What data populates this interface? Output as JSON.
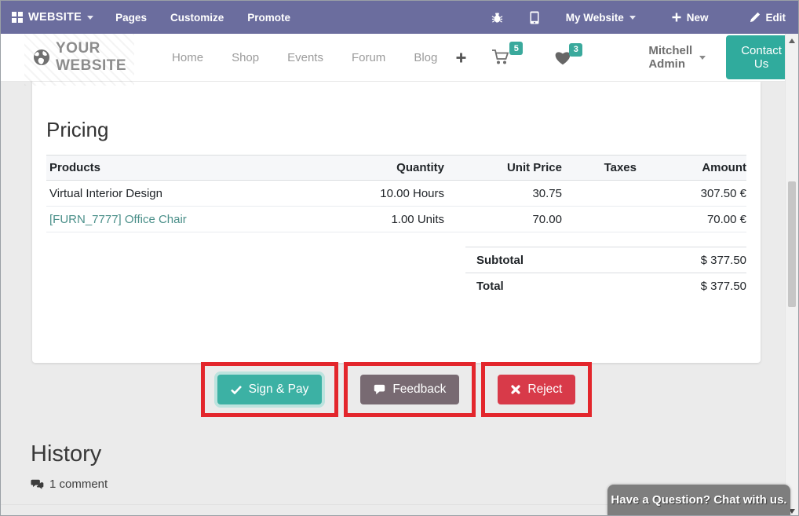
{
  "topbar": {
    "app_label": "WEBSITE",
    "items": [
      "Pages",
      "Customize",
      "Promote"
    ],
    "my_website": "My Website",
    "new_label": "New",
    "edit_label": "Edit"
  },
  "navbar": {
    "logo": "YOUR WEBSITE",
    "items": [
      "Home",
      "Shop",
      "Events",
      "Forum",
      "Blog"
    ],
    "cart_count": "5",
    "wishlist_count": "3",
    "user": "Mitchell Admin",
    "contact": "Contact Us"
  },
  "pricing": {
    "title": "Pricing",
    "headers": [
      "Products",
      "Quantity",
      "Unit Price",
      "Taxes",
      "Amount"
    ],
    "rows": [
      {
        "product": "Virtual Interior Design",
        "quantity": "10.00 Hours",
        "unit_price": "30.75",
        "taxes": "",
        "amount": "307.50 €"
      },
      {
        "product": "[FURN_7777] Office Chair",
        "quantity": "1.00 Units",
        "unit_price": "70.00",
        "taxes": "",
        "amount": "70.00 €"
      }
    ],
    "totals": [
      {
        "label": "Subtotal",
        "value": "$ 377.50"
      },
      {
        "label": "Total",
        "value": "$ 377.50"
      }
    ]
  },
  "actions": {
    "sign_pay": "Sign & Pay",
    "feedback": "Feedback",
    "reject": "Reject"
  },
  "history": {
    "title": "History",
    "comment_count": "1 comment"
  },
  "chat": {
    "label": "Have a Question? Chat with us."
  },
  "colors": {
    "topbar_purple": "#6b6d9e",
    "teal_button": "#30ab9d",
    "sign_pay_teal": "#3cb1a4",
    "feedback_plum": "#786a72",
    "reject_red": "#d83a49",
    "annotation_red": "#e3262c",
    "product_link_teal": "#4a8f89",
    "badge_teal": "#3aa99c",
    "page_background": "#ebebeb",
    "chat_gray": "#7e7e7e"
  }
}
